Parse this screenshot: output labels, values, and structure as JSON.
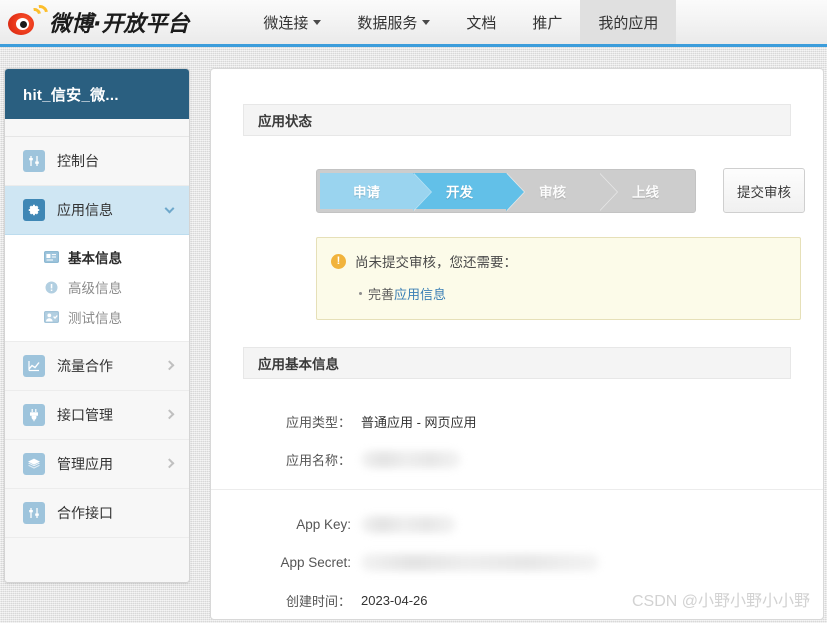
{
  "header": {
    "brand": "微博·开放平台",
    "logo_icon": "weibo-logo-icon",
    "nav": [
      {
        "label": "微连接",
        "has_caret": true,
        "active": false
      },
      {
        "label": "数据服务",
        "has_caret": true,
        "active": false
      },
      {
        "label": "文档",
        "has_caret": false,
        "active": false
      },
      {
        "label": "推广",
        "has_caret": false,
        "active": false
      },
      {
        "label": "我的应用",
        "has_caret": false,
        "active": true
      }
    ],
    "accent_color": "#3c9ddb"
  },
  "sidebar": {
    "app_title": "hit_信安_微...",
    "items": [
      {
        "label": "控制台",
        "icon": "sliders-icon",
        "chevron": "none",
        "active": false
      },
      {
        "label": "应用信息",
        "icon": "gear-icon",
        "chevron": "down",
        "active": true
      },
      {
        "label": "流量合作",
        "icon": "chart-icon",
        "chevron": "right",
        "active": false
      },
      {
        "label": "接口管理",
        "icon": "plug-icon",
        "chevron": "right",
        "active": false
      },
      {
        "label": "管理应用",
        "icon": "layers-icon",
        "chevron": "right",
        "active": false
      },
      {
        "label": "合作接口",
        "icon": "sliders-icon",
        "chevron": "none",
        "active": false
      }
    ],
    "submenu": [
      {
        "label": "基本信息",
        "icon": "id-card-icon",
        "active": true
      },
      {
        "label": "高级信息",
        "icon": "info-circle-icon",
        "active": false
      },
      {
        "label": "测试信息",
        "icon": "user-check-icon",
        "active": false
      }
    ]
  },
  "main": {
    "status_section": {
      "title": "应用状态",
      "steps": [
        {
          "label": "申请",
          "state": "done"
        },
        {
          "label": "开发",
          "state": "current"
        },
        {
          "label": "审核",
          "state": "todo"
        },
        {
          "label": "上线",
          "state": "todo"
        }
      ],
      "submit_button": "提交审核",
      "alert": {
        "icon": "warning-icon",
        "title": "尚未提交审核，您还需要：",
        "item_prefix": "完善",
        "item_link": "应用信息"
      }
    },
    "basic_section": {
      "title": "应用基本信息",
      "rows": [
        {
          "label": "应用类型：",
          "value": "普通应用  -  网页应用",
          "masked": false
        },
        {
          "label": "应用名称：",
          "value": "",
          "masked": true,
          "mask_width": 100
        },
        {
          "label": "App Key:",
          "value": "",
          "masked": true,
          "mask_width": 95
        },
        {
          "label": "App Secret:",
          "value": "",
          "masked": true,
          "mask_width": 238
        },
        {
          "label": "创建时间：",
          "value": "2023-04-26",
          "masked": false
        }
      ]
    }
  },
  "watermark": "CSDN @小野小野小小野"
}
